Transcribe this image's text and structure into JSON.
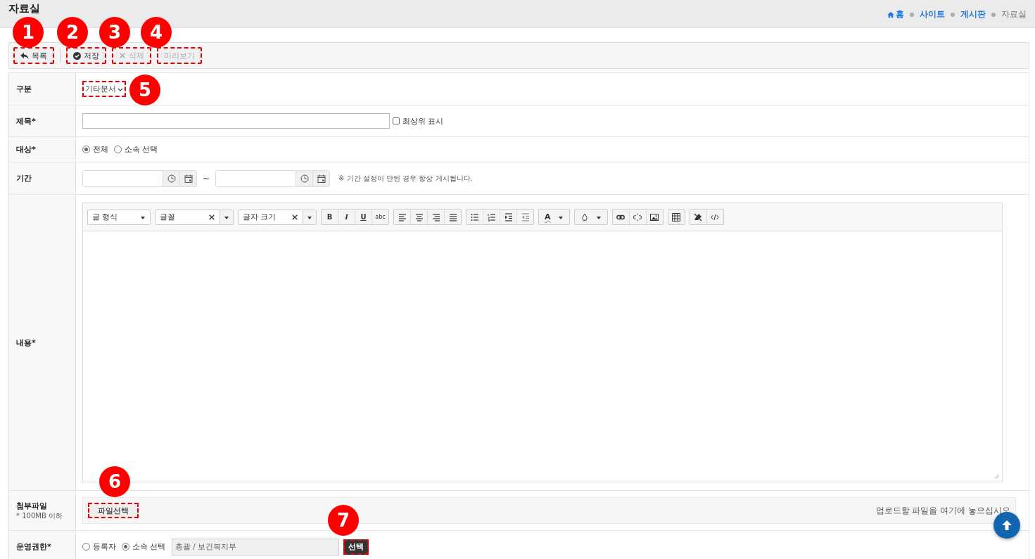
{
  "page": {
    "title": "자료실"
  },
  "breadcrumb": [
    {
      "label": "홈",
      "kind": "home"
    },
    {
      "label": "사이트",
      "kind": "link"
    },
    {
      "label": "게시판",
      "kind": "link"
    },
    {
      "label": "자료실",
      "kind": "current"
    }
  ],
  "toolbar": [
    {
      "label": "목록",
      "kind": "back",
      "disabled": false,
      "annotated": true
    },
    {
      "label": "저장",
      "kind": "save",
      "disabled": false,
      "annotated": true
    },
    {
      "label": "삭제",
      "kind": "delete",
      "disabled": true,
      "annotated": true
    },
    {
      "label": "미리보기",
      "kind": "preview",
      "disabled": true,
      "annotated": true
    }
  ],
  "form": {
    "category": {
      "label": "구분",
      "value": "기타문서",
      "annotated": true
    },
    "title": {
      "label": "제목*",
      "pin_label": "최상위 표시",
      "pin_checked": false
    },
    "target": {
      "label": "대상*",
      "options": [
        {
          "label": "전체",
          "selected": true
        },
        {
          "label": "소속 선택",
          "selected": false
        }
      ]
    },
    "period": {
      "label": "기간",
      "separator": "~",
      "note": "※ 기간 설정이 안된 경우 항상 게시됩니다."
    },
    "content": {
      "label": "내용*",
      "editor": {
        "dropdowns": [
          {
            "label": "글 형식",
            "clearable": false
          },
          {
            "label": "글꼴",
            "clearable": true
          },
          {
            "label": "글자 크기",
            "clearable": true
          }
        ],
        "format_buttons": [
          "B",
          "I",
          "U",
          "abc"
        ],
        "font_color": "A"
      }
    },
    "attachment": {
      "label": "첨부파일",
      "sublabel": "* 100MB 이하",
      "button": "파일선택",
      "hint": "업로드할 파일을 여기에 놓으십시오",
      "annotated": true
    },
    "permission": {
      "label": "운영권한*",
      "options": [
        {
          "label": "등록자",
          "selected": false
        },
        {
          "label": "소속 선택",
          "selected": true
        }
      ],
      "value": "총괄 / 보건복지부",
      "button": "선택",
      "annotated": true
    }
  },
  "callouts": [
    "1",
    "2",
    "3",
    "4",
    "5",
    "6",
    "7"
  ]
}
